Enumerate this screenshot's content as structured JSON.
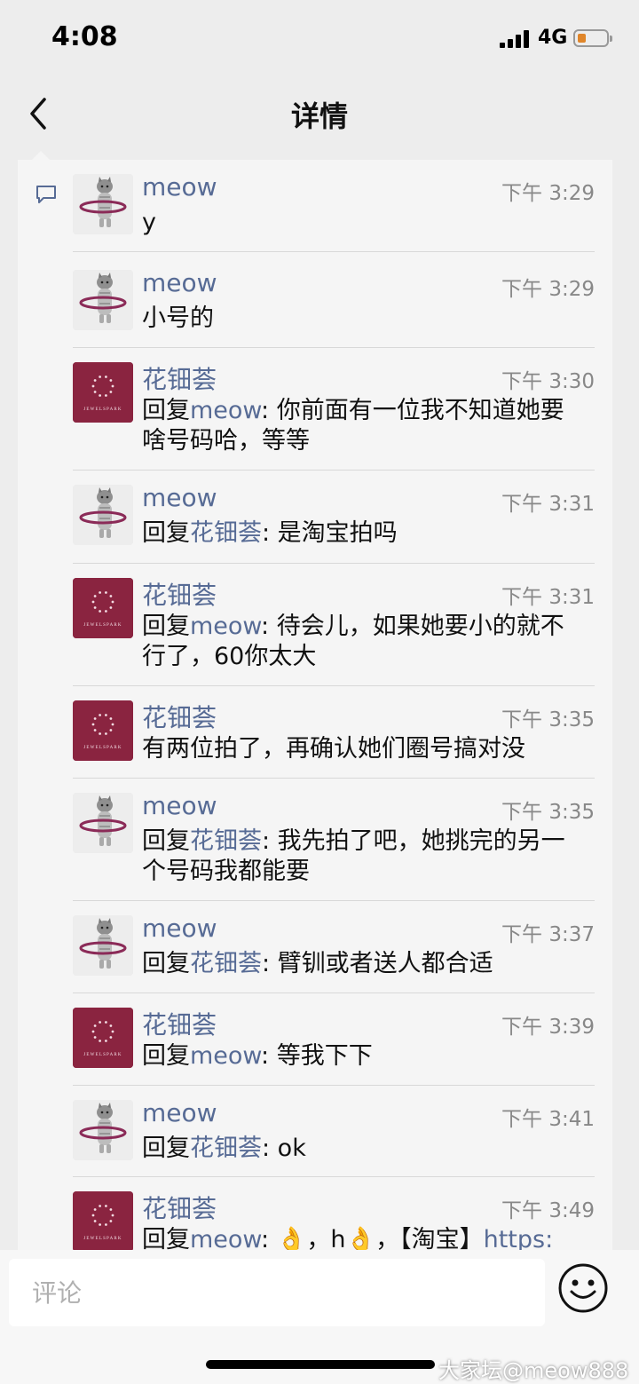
{
  "status_bar": {
    "time": "4:08",
    "network": "4G",
    "battery_level": 0.2
  },
  "nav": {
    "title": "详情"
  },
  "messages": [
    {
      "name": "meow",
      "time": "下午 3:29",
      "avatar": "cat",
      "reply_prefix": "",
      "reply_to": "",
      "text_lines": [
        "y"
      ]
    },
    {
      "name": "meow",
      "time": "下午 3:29",
      "avatar": "cat",
      "reply_prefix": "",
      "reply_to": "",
      "text_lines": [
        "小号的"
      ]
    },
    {
      "name": "花钿荟",
      "time": "下午 3:30",
      "avatar": "brand",
      "reply_prefix": "回复",
      "reply_to": "meow",
      "text_lines": [
        ": 你前面有一位我不知道她要",
        "啥号码哈，等等"
      ]
    },
    {
      "name": "meow",
      "time": "下午 3:31",
      "avatar": "cat",
      "reply_prefix": "回复",
      "reply_to": "花钿荟",
      "text_lines": [
        ": 是淘宝拍吗"
      ]
    },
    {
      "name": "花钿荟",
      "time": "下午 3:31",
      "avatar": "brand",
      "reply_prefix": "回复",
      "reply_to": "meow",
      "text_lines": [
        ": 待会儿，如果她要小的就不",
        "行了，60你太大"
      ]
    },
    {
      "name": "花钿荟",
      "time": "下午 3:35",
      "avatar": "brand",
      "reply_prefix": "",
      "reply_to": "",
      "text_lines": [
        "有两位拍了，再确认她们圈号搞对没"
      ]
    },
    {
      "name": "meow",
      "time": "下午 3:35",
      "avatar": "cat",
      "reply_prefix": "回复",
      "reply_to": "花钿荟",
      "text_lines": [
        ": 我先拍了吧，她挑完的另一",
        "个号码我都能要"
      ]
    },
    {
      "name": "meow",
      "time": "下午 3:37",
      "avatar": "cat",
      "reply_prefix": "回复",
      "reply_to": "花钿荟",
      "text_lines": [
        ": 臂钏或者送人都合适"
      ]
    },
    {
      "name": "花钿荟",
      "time": "下午 3:39",
      "avatar": "brand",
      "reply_prefix": "回复",
      "reply_to": "meow",
      "text_lines": [
        ": 等我下下"
      ]
    },
    {
      "name": "meow",
      "time": "下午 3:41",
      "avatar": "cat",
      "reply_prefix": "回复",
      "reply_to": "花钿荟",
      "text_lines": [
        ": ok"
      ]
    },
    {
      "name": "花钿荟",
      "time": "下午 3:49",
      "avatar": "brand",
      "reply_prefix": "回复",
      "reply_to": "meow",
      "text_lines": [
        ": 👌，h👌，【淘宝】"
      ],
      "link": "https:"
    }
  ],
  "brand_avatar_text": "JEWELSPARK",
  "input": {
    "placeholder": "评论"
  },
  "watermark": "大家坛@meow888",
  "colors": {
    "name_blue": "#576b95",
    "brand_red": "#8a2440",
    "background": "#ededed",
    "panel": "#f5f5f5"
  }
}
